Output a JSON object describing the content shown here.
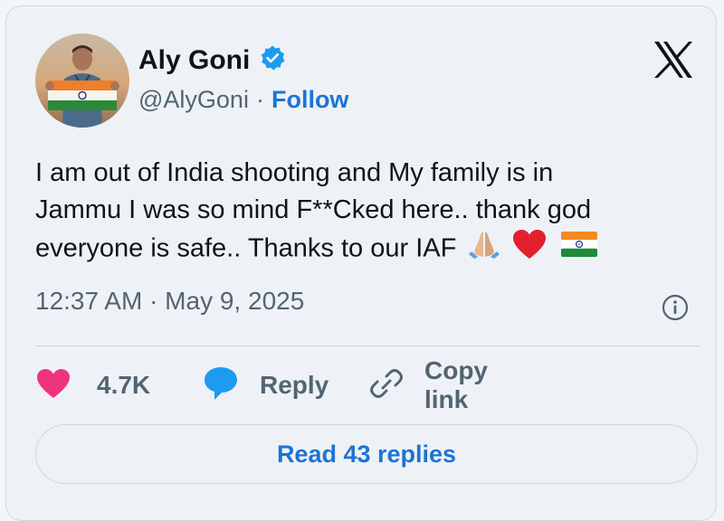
{
  "tweet": {
    "author": {
      "name": "Aly Goni",
      "handle": "@AlyGoni",
      "verified": true
    },
    "follow_label": "Follow",
    "separator": "·",
    "text_lines": [
      "I am out of India shooting and My family is in",
      "Jammu I was so mind F**Cked here.. thank god",
      "everyone is safe.. Thanks to our IAF"
    ],
    "emojis": [
      "folded-hands",
      "red-heart",
      "india-flag"
    ],
    "timestamp": "12:37 AM · May 9, 2025"
  },
  "actions": {
    "likes_count": "4.7K",
    "reply_label": "Reply",
    "copy_link_label": "Copy link"
  },
  "read_replies_label": "Read 43 replies",
  "colors": {
    "accent": "#1d74d4",
    "like": "#f0337e",
    "background": "#eef2f6",
    "muted": "#536471"
  }
}
